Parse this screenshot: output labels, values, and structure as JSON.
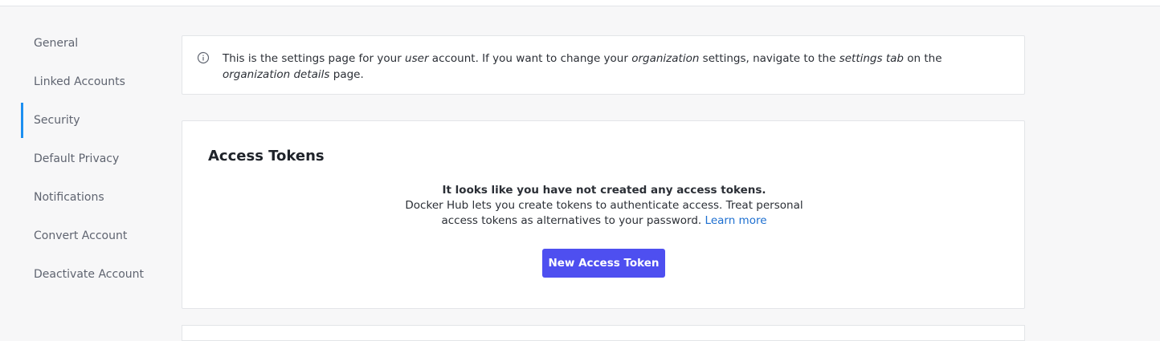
{
  "sidebar": {
    "items": [
      {
        "label": "General"
      },
      {
        "label": "Linked Accounts"
      },
      {
        "label": "Security",
        "active": true
      },
      {
        "label": "Default Privacy"
      },
      {
        "label": "Notifications"
      },
      {
        "label": "Convert Account"
      },
      {
        "label": "Deactivate Account"
      }
    ]
  },
  "banner": {
    "icon": "info-icon",
    "text_1": "This is the settings page for your ",
    "em_1": "user",
    "text_2": " account. If you want to change your ",
    "em_2": "organization",
    "text_3": " settings, navigate to the ",
    "em_3": "settings tab",
    "text_4": " on the ",
    "em_4": "organization details",
    "text_5": " page."
  },
  "access_tokens": {
    "title": "Access Tokens",
    "empty_headline": "It looks like you have not created any access tokens.",
    "empty_description": "Docker Hub lets you create tokens to authenticate access. Treat personal access tokens as alternatives to your password.",
    "learn_more": "Learn more",
    "new_button": "New Access Token"
  },
  "colors": {
    "accent": "#1d8ff0",
    "primary_button": "#4e4ff0",
    "link": "#1d6fd0"
  }
}
